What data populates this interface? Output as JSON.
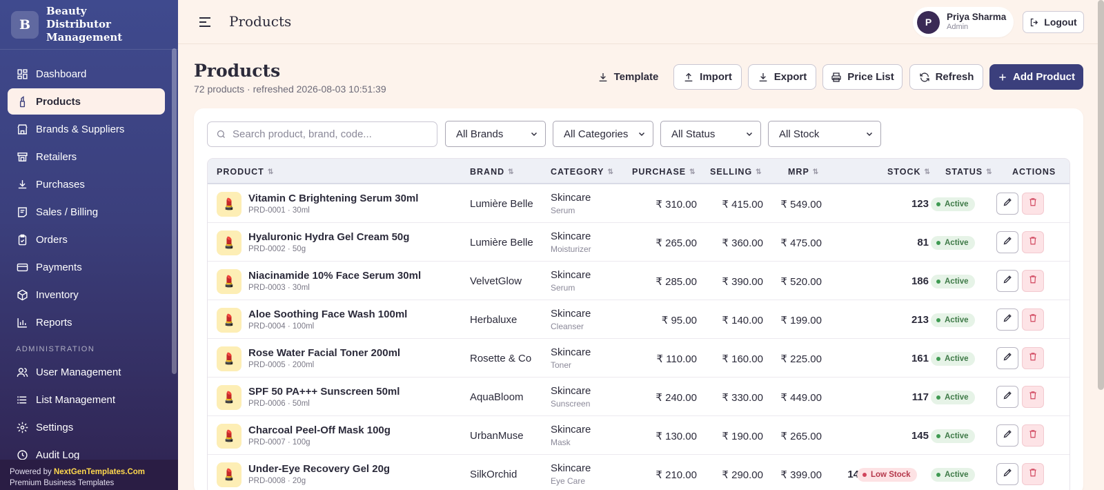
{
  "app": {
    "logo_letter": "B",
    "name": "Beauty Distributor Management"
  },
  "sidebar": {
    "items": [
      {
        "label": "Dashboard",
        "icon": "dashboard-icon"
      },
      {
        "label": "Products",
        "icon": "lipstick-icon",
        "active": true
      },
      {
        "label": "Brands & Suppliers",
        "icon": "store-icon"
      },
      {
        "label": "Retailers",
        "icon": "shop-icon"
      },
      {
        "label": "Purchases",
        "icon": "download-icon"
      },
      {
        "label": "Sales / Billing",
        "icon": "receipt-icon"
      },
      {
        "label": "Orders",
        "icon": "clipboard-icon"
      },
      {
        "label": "Payments",
        "icon": "card-icon"
      },
      {
        "label": "Inventory",
        "icon": "box-icon"
      },
      {
        "label": "Reports",
        "icon": "chart-icon"
      }
    ],
    "admin_section": "ADMINISTRATION",
    "admin_items": [
      {
        "label": "User Management",
        "icon": "users-icon"
      },
      {
        "label": "List Management",
        "icon": "list-icon"
      },
      {
        "label": "Settings",
        "icon": "gear-icon"
      },
      {
        "label": "Audit Log",
        "icon": "clock-icon"
      }
    ],
    "footer": {
      "powered_prefix": "Powered by ",
      "powered_brand": "NextGenTemplates.Com",
      "tagline": "Premium Business Templates"
    }
  },
  "topbar": {
    "title": "Products",
    "user": {
      "initial": "P",
      "name": "Priya Sharma",
      "role": "Admin"
    },
    "logout_label": "Logout"
  },
  "page": {
    "title": "Products",
    "subtitle": "72 products · refreshed 2026-08-03 10:51:39",
    "actions": {
      "template": "Template",
      "import": "Import",
      "export": "Export",
      "price_list": "Price List",
      "refresh": "Refresh",
      "add": "Add Product"
    }
  },
  "filters": {
    "search_placeholder": "Search product, brand, code...",
    "brands": "All Brands",
    "categories": "All Categories",
    "status": "All Status",
    "stock": "All Stock"
  },
  "table": {
    "headers": {
      "product": "PRODUCT",
      "brand": "BRAND",
      "category": "CATEGORY",
      "purchase": "PURCHASE",
      "selling": "SELLING",
      "mrp": "MRP",
      "stock": "STOCK",
      "status": "STATUS",
      "actions": "ACTIONS"
    },
    "rows": [
      {
        "name": "Vitamin C Brightening Serum 30ml",
        "code": "PRD-0001 · 30ml",
        "brand": "Lumière Belle",
        "category": "Skincare",
        "subcategory": "Serum",
        "purchase": "₹ 310.00",
        "selling": "₹ 415.00",
        "mrp": "₹ 549.00",
        "stock": "123",
        "stock_flag": "",
        "status": "Active"
      },
      {
        "name": "Hyaluronic Hydra Gel Cream 50g",
        "code": "PRD-0002 · 50g",
        "brand": "Lumière Belle",
        "category": "Skincare",
        "subcategory": "Moisturizer",
        "purchase": "₹ 265.00",
        "selling": "₹ 360.00",
        "mrp": "₹ 475.00",
        "stock": "81",
        "stock_flag": "",
        "status": "Active"
      },
      {
        "name": "Niacinamide 10% Face Serum 30ml",
        "code": "PRD-0003 · 30ml",
        "brand": "VelvetGlow",
        "category": "Skincare",
        "subcategory": "Serum",
        "purchase": "₹ 285.00",
        "selling": "₹ 390.00",
        "mrp": "₹ 520.00",
        "stock": "186",
        "stock_flag": "",
        "status": "Active"
      },
      {
        "name": "Aloe Soothing Face Wash 100ml",
        "code": "PRD-0004 · 100ml",
        "brand": "Herbaluxe",
        "category": "Skincare",
        "subcategory": "Cleanser",
        "purchase": "₹ 95.00",
        "selling": "₹ 140.00",
        "mrp": "₹ 199.00",
        "stock": "213",
        "stock_flag": "",
        "status": "Active"
      },
      {
        "name": "Rose Water Facial Toner 200ml",
        "code": "PRD-0005 · 200ml",
        "brand": "Rosette & Co",
        "category": "Skincare",
        "subcategory": "Toner",
        "purchase": "₹ 110.00",
        "selling": "₹ 160.00",
        "mrp": "₹ 225.00",
        "stock": "161",
        "stock_flag": "",
        "status": "Active"
      },
      {
        "name": "SPF 50 PA+++ Sunscreen 50ml",
        "code": "PRD-0006 · 50ml",
        "brand": "AquaBloom",
        "category": "Skincare",
        "subcategory": "Sunscreen",
        "purchase": "₹ 240.00",
        "selling": "₹ 330.00",
        "mrp": "₹ 449.00",
        "stock": "117",
        "stock_flag": "",
        "status": "Active"
      },
      {
        "name": "Charcoal Peel-Off Mask 100g",
        "code": "PRD-0007 · 100g",
        "brand": "UrbanMuse",
        "category": "Skincare",
        "subcategory": "Mask",
        "purchase": "₹ 130.00",
        "selling": "₹ 190.00",
        "mrp": "₹ 265.00",
        "stock": "145",
        "stock_flag": "",
        "status": "Active"
      },
      {
        "name": "Under-Eye Recovery Gel 20g",
        "code": "PRD-0008 · 20g",
        "brand": "SilkOrchid",
        "category": "Skincare",
        "subcategory": "Eye Care",
        "purchase": "₹ 210.00",
        "selling": "₹ 290.00",
        "mrp": "₹ 399.00",
        "stock": "14",
        "stock_flag": "Low Stock",
        "status": "Active"
      }
    ]
  },
  "colors": {
    "primary": "#3b3f7c",
    "page_bg": "#fdf3ec",
    "active_badge": "#e6f3e7",
    "low_badge": "#fde2e4"
  }
}
